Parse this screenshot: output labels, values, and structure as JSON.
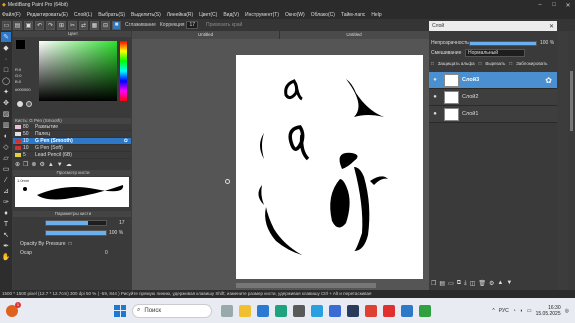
{
  "app": {
    "title": "MediBang Paint Pro (64bit)"
  },
  "menu": [
    "Файл(F)",
    "Редактировать(E)",
    "Слой(L)",
    "Выбрать(S)",
    "Выделить(S)",
    "Линейка(R)",
    "Цвет(C)",
    "Вид(V)",
    "Инструмент(T)",
    "Окно(W)",
    "Облако(C)",
    "Тайм-лапс",
    "Help"
  ],
  "toolbar": {
    "antialias": "Сглаживание",
    "correction_label": "Коррекция",
    "correction_value": "17",
    "snap": "Привязать край"
  },
  "color_panel": {
    "title": "Цвет",
    "r": "R:0",
    "g": "G:0",
    "b": "B:0",
    "hex": "#000000"
  },
  "brushes": {
    "title": "Кисть: G Pen (Smooth)",
    "items": [
      {
        "size": "80",
        "name": "Размытие",
        "color": "#e8c0d8"
      },
      {
        "size": "50",
        "name": "Палец",
        "color": "#e0e0e0"
      },
      {
        "size": "10",
        "name": "G Pen (Smooth)",
        "color": "#cc3333"
      },
      {
        "size": "10",
        "name": "G Pen (Soft)",
        "color": "#cc3333"
      },
      {
        "size": "5",
        "name": "Lead Pencil (6B)",
        "color": "#e0d040"
      }
    ]
  },
  "preview": {
    "title": "Просмотр кисти",
    "size": "1.0mm"
  },
  "brush_params": {
    "title": "Параметры кисти",
    "width": "17",
    "opacity": "100 %",
    "pressure": "Opacity By Pressure",
    "ocap": "Ocap",
    "ocap_value": "0"
  },
  "canvas": {
    "tab_left": "Untitled",
    "tab_right": "Untitled"
  },
  "layers": {
    "title": "Слой",
    "opacity_label": "Непрозрачность",
    "opacity_value": "100 %",
    "blend_label": "Смешивание",
    "blend_value": "Нормальный",
    "protect_alpha": "Защищать альфа",
    "clip": "Вырезать",
    "lock": "Заблокировать",
    "items": [
      {
        "name": "Слой3",
        "selected": true
      },
      {
        "name": "Слой2",
        "selected": false
      },
      {
        "name": "Слой1",
        "selected": false
      }
    ]
  },
  "status": {
    "text": "1500 * 1500 pixel   (12.7 * 12.7cm)   300 dpi   50 %   ( -59, 844 )   Рисуйте прямую линию, удерживая клавишу Shift; измените размер кисти, удерживая клавишу Ctrl + Alt и перетаскивая"
  },
  "taskbar": {
    "search_placeholder": "Поиск",
    "lang": "РУС",
    "time": "16:30",
    "date": "15.05.2025",
    "badge": "1"
  },
  "colors": {
    "accent": "#2e79c7",
    "selected_layer": "#4a8fd0"
  }
}
